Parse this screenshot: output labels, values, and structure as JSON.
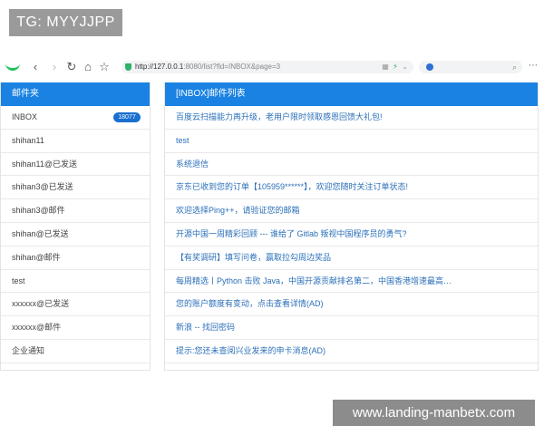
{
  "watermark": {
    "tag": "TG: MYYJJPP",
    "site": "www.landing-manbetx.com"
  },
  "browser": {
    "url_host": "http://127.0.0.1",
    "url_rest": ":8080/list?fld=INBOX&page=3"
  },
  "left_panel": {
    "header": "邮件夹",
    "inbox_label": "INBOX",
    "inbox_count": "18077",
    "folders": [
      "shihan11",
      "shihan11@已发送",
      "shihan3@已发送",
      "shihan3@邮件",
      "shihan@已发送",
      "shihan@邮件",
      "test",
      "xxxxxx@已发送",
      "xxxxxx@邮件",
      "企业通知"
    ]
  },
  "right_panel": {
    "header": "[INBOX]邮件列表",
    "mails": [
      "百度云扫描能力再升级，老用户限时领取感恩回馈大礼包!",
      "test",
      "系统退信",
      "京东已收到您的订单【105959******】，欢迎您随时关注订单状态!",
      "欢迎选择Ping++，请验证您的邮箱",
      "开源中国一周精彩回顾 --- 谁给了 Gitlab 叛视中国程序员的勇气?",
      "【有奖调研】填写问卷，赢取拉勾周边奖品",
      "每周精选丨Python 击败 Java，中国开源贡献排名第二，中国香港增速最高…",
      "您的账户额度有变动，点击查看详情(AD)",
      "新浪 -- 找回密码",
      "提示:您还未查阅兴业发来的申卡消息(AD)"
    ]
  }
}
